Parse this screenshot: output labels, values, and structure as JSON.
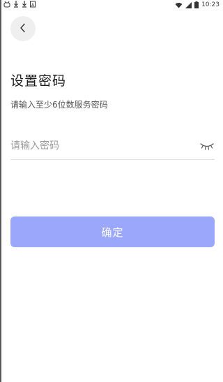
{
  "status_bar": {
    "left_icons": [
      "android-debug-icon",
      "download-icon",
      "download-icon",
      "notification-icon"
    ],
    "time": "10:23"
  },
  "header": {
    "back_icon": "chevron-left-icon"
  },
  "title": "设置密码",
  "subtitle": "请输入至少6位数服务密码",
  "password_field": {
    "placeholder": "请输入密码",
    "value": "",
    "toggle_icon": "eye-closed-icon"
  },
  "confirm_button": {
    "label": "确定",
    "color": "#9aa7fb"
  }
}
